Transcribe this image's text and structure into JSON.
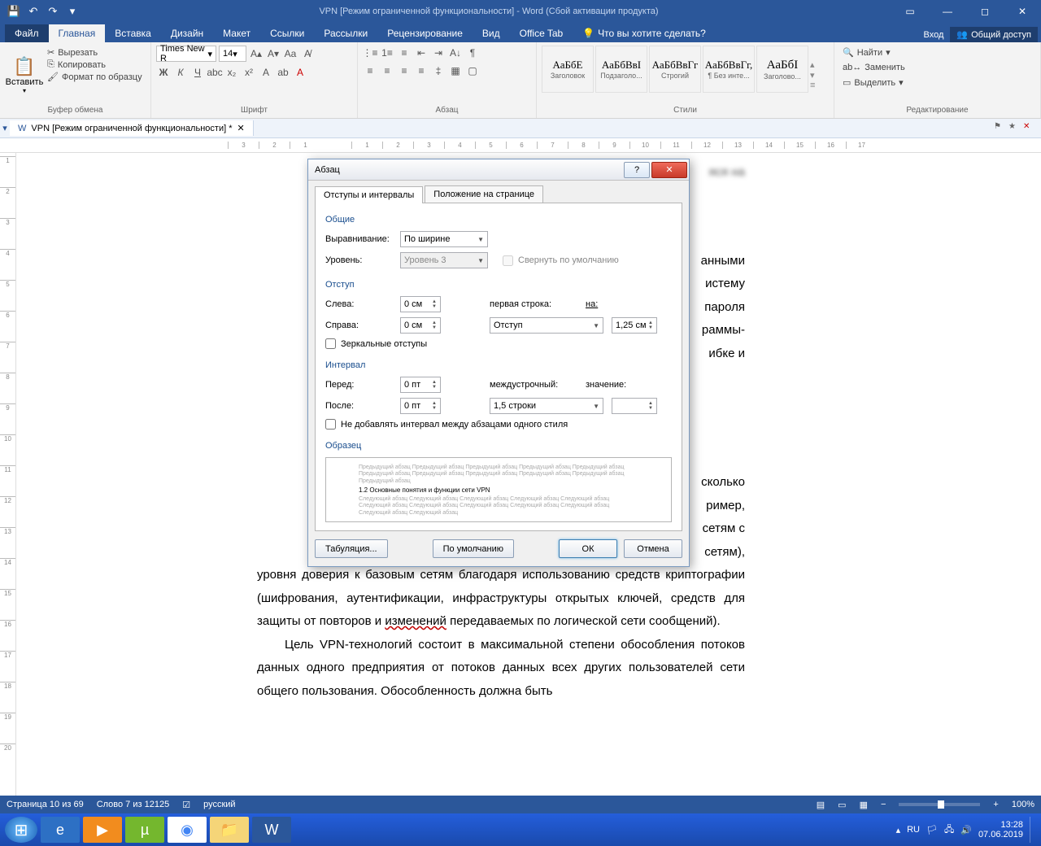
{
  "titlebar": {
    "title": "VPN [Режим ограниченной функциональности] - Word (Сбой активации продукта)"
  },
  "ribbon": {
    "tabs": {
      "file": "Файл",
      "home": "Главная",
      "insert": "Вставка",
      "design": "Дизайн",
      "layout": "Макет",
      "references": "Ссылки",
      "mailings": "Рассылки",
      "review": "Рецензирование",
      "view": "Вид",
      "officetab": "Office Tab",
      "tellme": "Что вы хотите сделать?"
    },
    "right": {
      "signin": "Вход",
      "share": "Общий доступ"
    },
    "clipboard": {
      "paste": "Вставить",
      "cut": "Вырезать",
      "copy": "Копировать",
      "format_painter": "Формат по образцу",
      "label": "Буфер обмена"
    },
    "font": {
      "name": "Times New R",
      "size": "14",
      "label": "Шрифт"
    },
    "paragraph": {
      "label": "Абзац"
    },
    "styles": {
      "label": "Стили",
      "items": [
        {
          "preview": "АаБбЕ",
          "name": "Заголовок"
        },
        {
          "preview": "АаБбВвІ",
          "name": "Подзаголо..."
        },
        {
          "preview": "АаБбВвГг",
          "name": "Строгий"
        },
        {
          "preview": "АаБбВвГг,",
          "name": "¶ Без инте..."
        },
        {
          "preview": "АаБбI",
          "name": "Заголово..."
        }
      ]
    },
    "editing": {
      "find": "Найти",
      "replace": "Заменить",
      "select": "Выделить",
      "label": "Редактирование"
    }
  },
  "doctab": {
    "name": "VPN [Режим ограниченной функциональности] *"
  },
  "document": {
    "frag_right1": "яся на",
    "frag_right2_l1": "анными",
    "frag_right2_l2": "истему",
    "frag_right2_l3": "пароля",
    "frag_right2_l4": "раммы-",
    "frag_right2_l5": "ибке и",
    "frag_right3_l1": "сколько",
    "frag_right3_l2": "ример,",
    "frag_right3_l3": "сетям с",
    "frag_right3_l4": "сетям),",
    "p1": "уровня доверия к базовым сетям благодаря использованию средств криптографии (шифрования, аутентификации, инфраструктуры открытых ключей, средств для защиты от повторов и ",
    "p1_u": "изменений",
    "p1_tail": " передаваемых по логической сети сообщений).",
    "p2": "Цель VPN-технологий состоит в максимальной степени обособления потоков данных одного предприятия от потоков данных всех других пользователей сети общего пользования. Обособленность должна быть"
  },
  "dialog": {
    "title": "Абзац",
    "tab1": "Отступы и интервалы",
    "tab2": "Положение на странице",
    "sec_general": "Общие",
    "alignment_label": "Выравнивание:",
    "alignment_value": "По ширине",
    "level_label": "Уровень:",
    "level_value": "Уровень 3",
    "collapse": "Свернуть по умолчанию",
    "sec_indent": "Отступ",
    "left_label": "Слева:",
    "left_value": "0 см",
    "right_label": "Справа:",
    "right_value": "0 см",
    "firstline_label": "первая строка:",
    "firstline_value": "Отступ",
    "by_label": "на:",
    "by_value": "1,25 см",
    "mirror": "Зеркальные отступы",
    "sec_spacing": "Интервал",
    "before_label": "Перед:",
    "before_value": "0 пт",
    "after_label": "После:",
    "after_value": "0 пт",
    "line_label": "междустрочный:",
    "line_value": "1,5 строки",
    "at_label": "значение:",
    "at_value": "",
    "no_space": "Не добавлять интервал между абзацами одного стиля",
    "sec_preview": "Образец",
    "preview_before": "Предыдущий абзац Предыдущий абзац Предыдущий абзац Предыдущий абзац Предыдущий абзац Предыдущий абзац Предыдущий абзац Предыдущий абзац Предыдущий абзац Предыдущий абзац Предыдущий абзац",
    "preview_sample": "1.2 Основные понятия и функции сети VPN",
    "preview_after": "Следующий абзац Следующий абзац Следующий абзац Следующий абзац Следующий абзац Следующий абзац Следующий абзац Следующий абзац Следующий абзац Следующий абзац Следующий абзац Следующий абзац",
    "btn_tabs": "Табуляция...",
    "btn_default": "По умолчанию",
    "btn_ok": "ОК",
    "btn_cancel": "Отмена"
  },
  "statusbar": {
    "page": "Страница 10 из 69",
    "words": "Слово 7 из 12125",
    "lang": "русский",
    "zoom": "100%"
  },
  "taskbar": {
    "lang": "RU",
    "time": "13:28",
    "date": "07.06.2019"
  }
}
